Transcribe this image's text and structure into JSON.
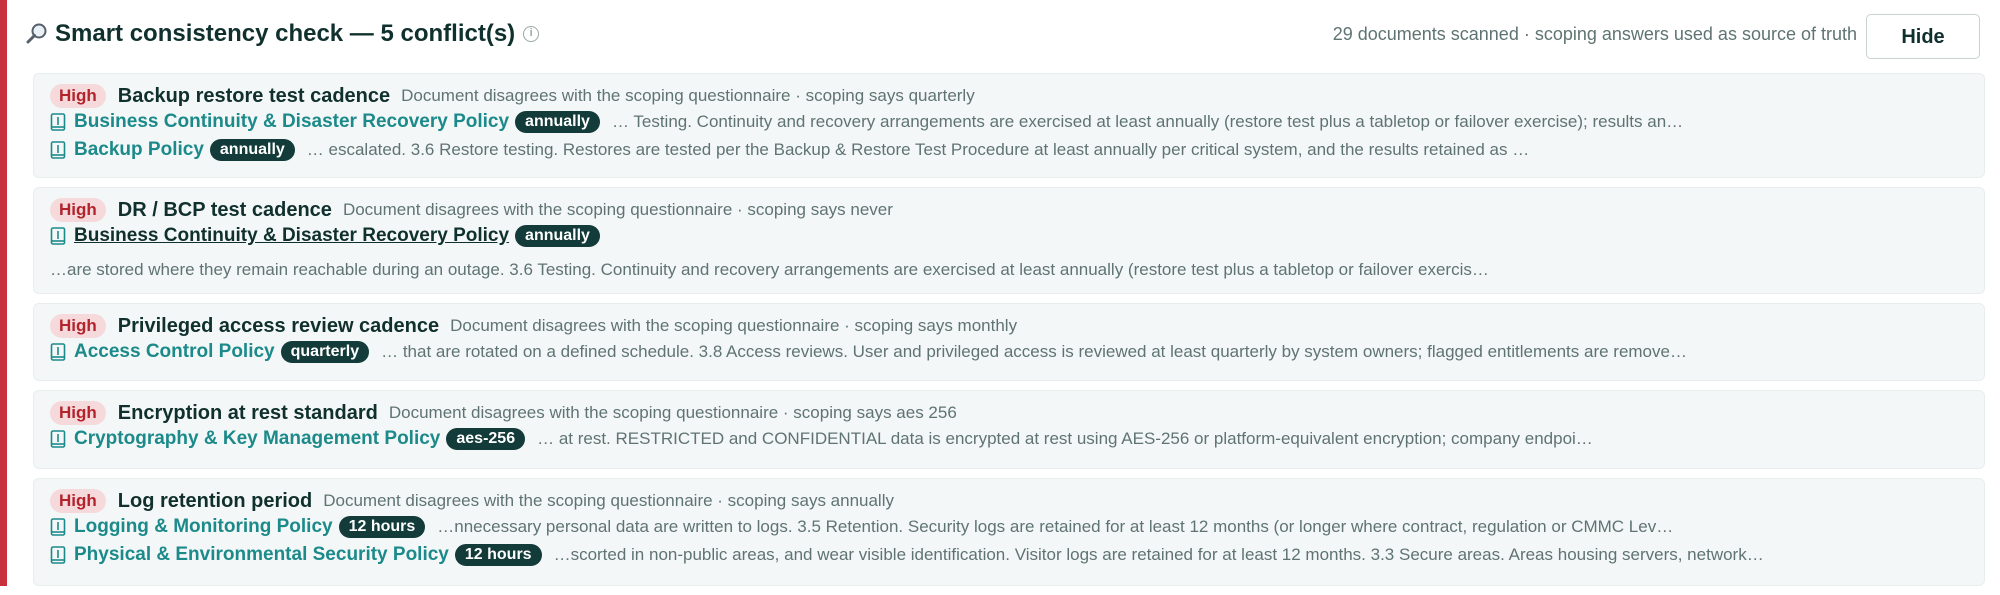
{
  "header": {
    "title": "Smart consistency check — 5 conflict(s)",
    "summary": "29 documents scanned · scoping answers used as source of truth",
    "hide_label": "Hide",
    "info_glyph": "i"
  },
  "colors": {
    "accent_border": "#c8303b",
    "high_badge_bg": "#f6d9db",
    "high_badge_text": "#b3232c",
    "link": "#1c8a8a",
    "pill_bg": "#123b3a"
  },
  "conflicts": [
    {
      "severity": "High",
      "title": "Backup restore test cadence",
      "description": "Document disagrees with the scoping questionnaire · scoping says quarterly",
      "docs": [
        {
          "name": "Business Continuity & Disaster Recovery Policy",
          "value": "annually",
          "snippet": "… Testing. Continuity and recovery arrangements are exercised at least annually (restore test plus a tabletop or failover exercise); results an…"
        },
        {
          "name": "Backup Policy",
          "value": "annually",
          "snippet": "… escalated. 3.6 Restore testing. Restores are tested per the Backup & Restore Test Procedure at least annually per critical system, and the results retained as …"
        }
      ]
    },
    {
      "severity": "High",
      "title": "DR / BCP test cadence",
      "description": "Document disagrees with the scoping questionnaire · scoping says never",
      "docs": [
        {
          "name": "Business Continuity & Disaster Recovery Policy",
          "value": "annually"
        }
      ],
      "snippet": "…are stored where they remain reachable during an outage. 3.6 Testing. Continuity and recovery arrangements are exercised at least annually (restore test plus a tabletop or failover exercis…"
    },
    {
      "severity": "High",
      "title": "Privileged access review cadence",
      "description": "Document disagrees with the scoping questionnaire · scoping says monthly",
      "docs": [
        {
          "name": "Access Control Policy",
          "value": "quarterly",
          "snippet": "… that are rotated on a defined schedule. 3.8 Access reviews. User and privileged access is reviewed at least quarterly by system owners; flagged entitlements are remove…"
        }
      ]
    },
    {
      "severity": "High",
      "title": "Encryption at rest standard",
      "description": "Document disagrees with the scoping questionnaire · scoping says aes 256",
      "docs": [
        {
          "name": "Cryptography & Key Management Policy",
          "value": "aes-256",
          "snippet": "… at rest. RESTRICTED and CONFIDENTIAL data is encrypted at rest using AES-256 or platform-equivalent encryption; company endpoi…"
        }
      ]
    },
    {
      "severity": "High",
      "title": "Log retention period",
      "description": "Document disagrees with the scoping questionnaire · scoping says annually",
      "docs": [
        {
          "name": "Logging & Monitoring Policy",
          "value": "12 hours",
          "snippet": "…nnecessary personal data are written to logs. 3.5 Retention. Security logs are retained for at least 12 months (or longer where contract, regulation or CMMC Lev…"
        },
        {
          "name": "Physical & Environmental Security Policy",
          "value": "12 hours",
          "snippet": "…scorted in non-public areas, and wear visible identification. Visitor logs are retained for at least 12 months. 3.3 Secure areas. Areas housing servers, network…"
        }
      ]
    }
  ]
}
